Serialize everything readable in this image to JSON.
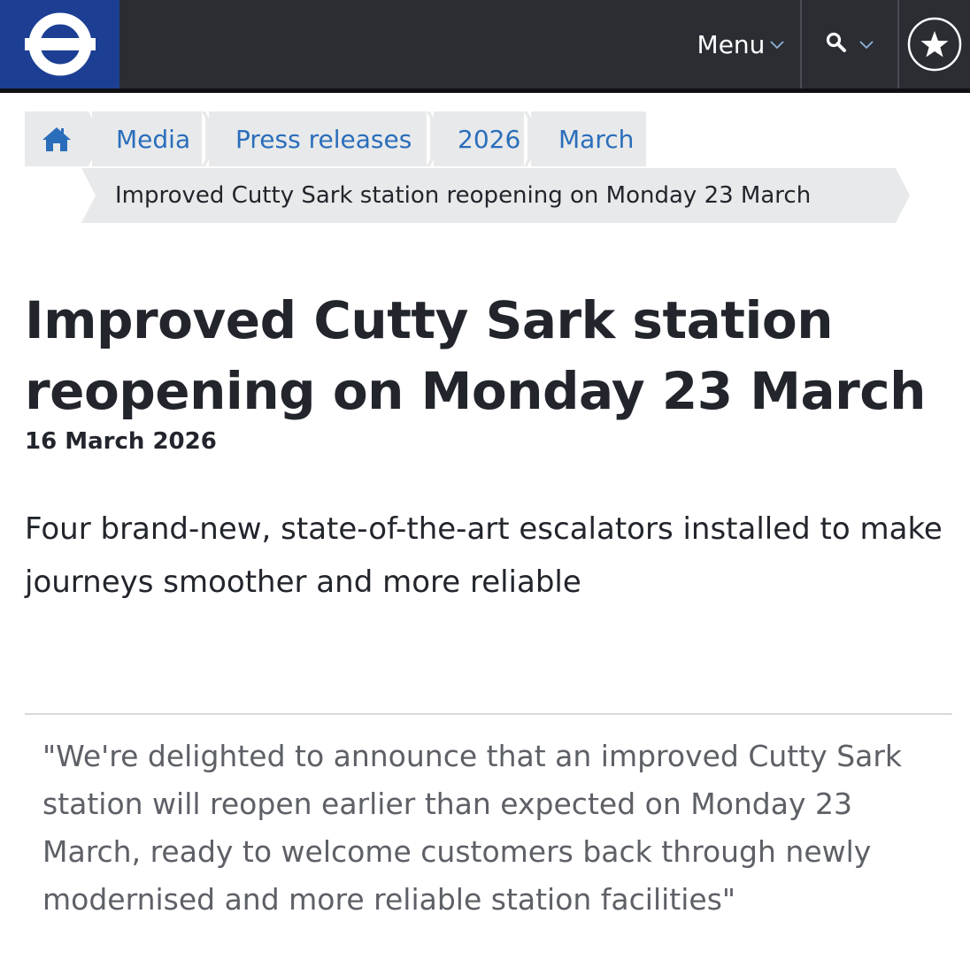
{
  "header": {
    "logo_name": "roundel",
    "menu_label": "Menu",
    "chevron": "⌄",
    "colors": {
      "bar": "#2b2d33",
      "logo_bg": "#1c3f94"
    }
  },
  "breadcrumb": {
    "home_icon": "home-icon",
    "items": [
      "Media",
      "Press releases",
      "2026",
      "March"
    ],
    "current": "Improved Cutty Sark station reopening on Monday 23 March"
  },
  "article": {
    "title": "Improved Cutty Sark station reopening on Monday 23 March",
    "date": "16 March 2026",
    "standfirst": "Four brand-new, state-of-the-art escalators installed to make journeys smoother and more reliable",
    "quote": "\"We're delighted to announce that an improved Cutty Sark station will reopen earlier than expected on Monday 23 March, ready to welcome customers back through newly modernised and more reliable station facilities\""
  }
}
